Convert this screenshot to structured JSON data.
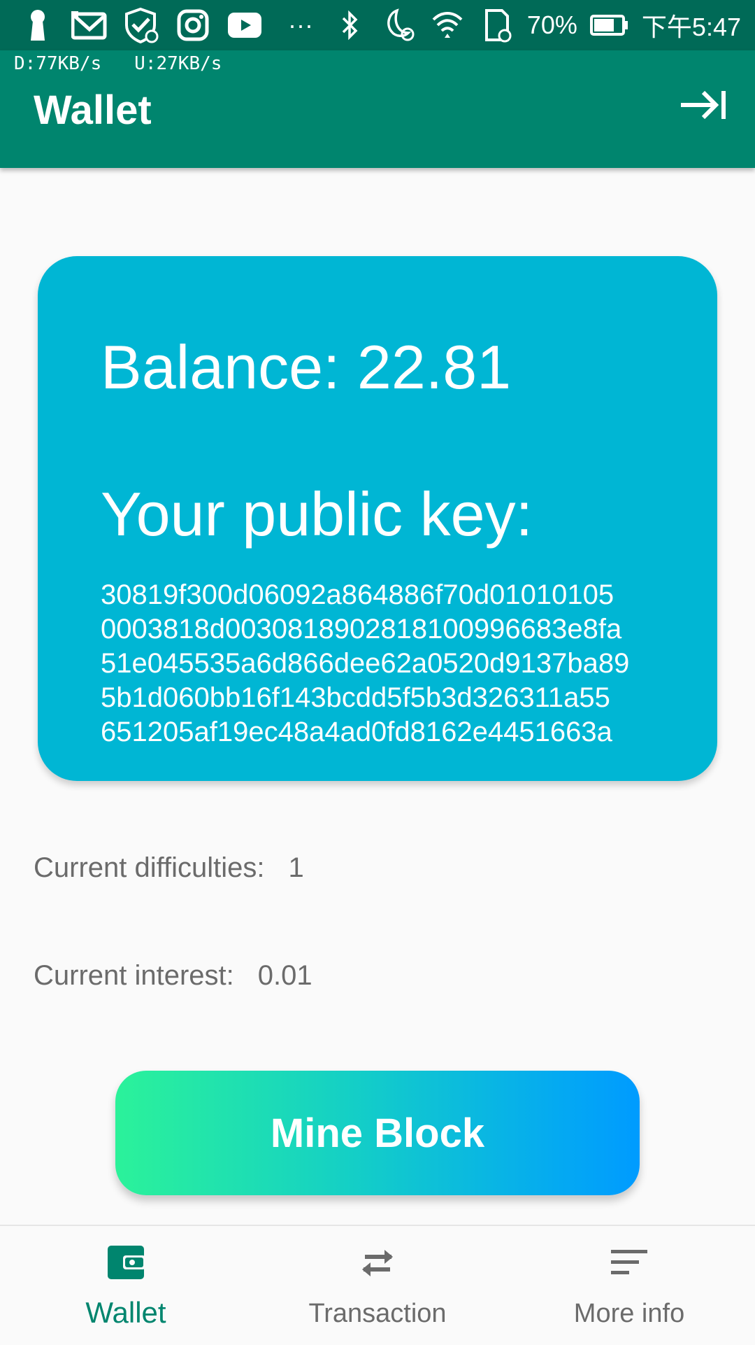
{
  "status_bar": {
    "battery_percent": "70%",
    "time": "下午5:47",
    "more_indicator": "···",
    "icons": [
      "keyhole-icon",
      "mail-icon",
      "shield-check-icon",
      "instagram-icon",
      "youtube-icon",
      "bluetooth-icon",
      "moon-alarm-icon",
      "wifi-icon",
      "sd-card-icon",
      "battery-icon"
    ]
  },
  "net_speed": "D:77KB/s   U:27KB/s",
  "app_bar": {
    "title": "Wallet",
    "action_icon": "logout-arrow-icon"
  },
  "card": {
    "balance_text": "Balance: 22.81",
    "public_key_label": "Your public key:",
    "public_key_lines": [
      "30819f300d06092a864886f70d01010105",
      "0003818d0030818902818100996683e8fa",
      "51e045535a6d866dee62a0520d9137ba89",
      "5b1d060bb16f143bcdd5f5b3d326311a55",
      "651205af19ec48a4ad0fd8162e4451663a"
    ]
  },
  "stats": {
    "difficulty_label": "Current difficulties:",
    "difficulty_value": "1",
    "interest_label": "Current interest:",
    "interest_value": "0.01"
  },
  "mine_button_label": "Mine Block",
  "colors": {
    "status_bar": "#006a57",
    "app_bar": "#00856e",
    "card": "#00b6d4",
    "gradient_start": "#2bf29a",
    "gradient_end": "#009bff",
    "active_nav": "#00856e",
    "inactive_nav": "#6b6b6b"
  },
  "bottom_nav": {
    "items": [
      {
        "label": "Wallet",
        "icon": "wallet-icon",
        "active": true
      },
      {
        "label": "Transaction",
        "icon": "swap-arrows-icon",
        "active": false
      },
      {
        "label": "More info",
        "icon": "sort-lines-icon",
        "active": false
      }
    ]
  }
}
